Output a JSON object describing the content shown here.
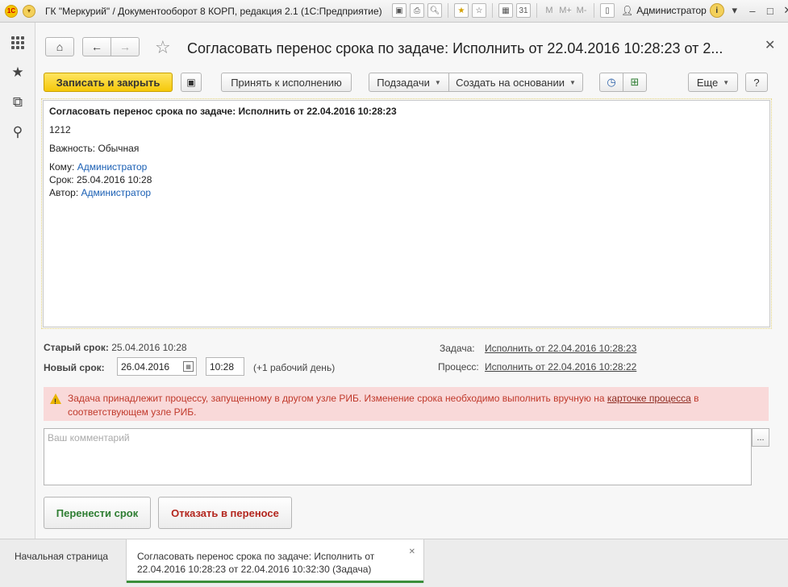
{
  "window": {
    "title": "ГК \"Меркурий\" / Документооборот 8 КОРП, редакция 2.1  (1С:Предприятие)",
    "user": "Администратор",
    "toolbar_icons": [
      "save-icon",
      "print-icon",
      "preview-icon",
      "favorite-icon",
      "bookmark-icon",
      "calculator-icon",
      "calendar-icon"
    ],
    "memory_labels": [
      "M",
      "M+",
      "M-"
    ]
  },
  "sidebar": {
    "items": [
      "apps-icon",
      "star-icon",
      "history-icon",
      "search-icon"
    ]
  },
  "form": {
    "title": "Согласовать перенос срока по задаче: Исполнить  от 22.04.2016 10:28:23 от 2...",
    "toolbar": {
      "save_close": "Записать и закрыть",
      "accept": "Принять к исполнению",
      "subtasks": "Подзадачи",
      "create_based": "Создать на основании",
      "more": "Еще",
      "help": "?"
    },
    "message": {
      "title": "Согласовать перенос срока по задаче: Исполнить от 22.04.2016 10:28:23",
      "body": "1212",
      "importance_label": "Важность:",
      "importance_value": "Обычная",
      "to_label": "Кому:",
      "to_value": "Администратор",
      "deadline_label": "Срок:",
      "deadline_value": "25.04.2016 10:28",
      "author_label": "Автор:",
      "author_value": "Администратор"
    },
    "old_deadline_label": "Старый срок:",
    "old_deadline_value": "25.04.2016 10:28",
    "new_deadline_label": "Новый срок:",
    "new_deadline_date": "26.04.2016",
    "new_deadline_time": "10:28",
    "new_deadline_hint": "(+1 рабочий день)",
    "task_label": "Задача:",
    "task_link": "Исполнить  от 22.04.2016 10:28:23",
    "process_label": "Процесс:",
    "process_link": "Исполнить  от 22.04.2016 10:28:22",
    "warning": {
      "text_before": "Задача принадлежит процессу, запущенному в другом узле РИБ. Изменение срока необходимо выполнить вручную на ",
      "link": "карточке процесса",
      "text_after": " в соответствующем узле РИБ."
    },
    "comment_placeholder": "Ваш комментарий",
    "dots": "...",
    "btn_transfer": "Перенести срок",
    "btn_reject": "Отказать в переносе",
    "colors": {
      "transfer": "#2e7d32",
      "reject": "#b3261e",
      "accent": "#f5c80a"
    }
  },
  "tabs": {
    "home": "Начальная страница",
    "active_line1": "Согласовать перенос срока по задаче: Исполнить  от",
    "active_line2": "22.04.2016 10:28:23 от 22.04.2016 10:32:30 (Задача)"
  }
}
